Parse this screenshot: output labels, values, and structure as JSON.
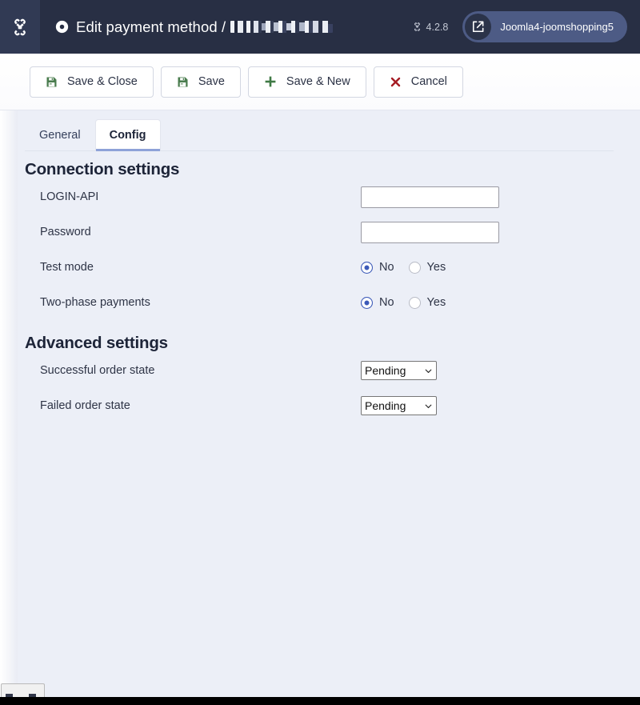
{
  "topbar": {
    "brand_icon": "joomla-logo-icon",
    "title_dot_icon": "circle-dot-icon",
    "title": "Edit payment method /",
    "title_redacted": true,
    "version_icon": "joomla-mark-icon",
    "version": "4.2.8",
    "site_link_icon": "external-link-icon",
    "site_name": "Joomla4-joomshopping5"
  },
  "toolbar": {
    "buttons": [
      {
        "label": "Save & Close",
        "icon": "save-icon",
        "icon_color": "#4a7c4e"
      },
      {
        "label": "Save",
        "icon": "save-icon",
        "icon_color": "#4a7c4e"
      },
      {
        "label": "Save & New",
        "icon": "plus-icon",
        "icon_color": "#3f7a45"
      },
      {
        "label": "Cancel",
        "icon": "close-x-icon",
        "icon_color": "#a51c24"
      }
    ]
  },
  "tabs": [
    {
      "label": "General",
      "active": false
    },
    {
      "label": "Config",
      "active": true
    }
  ],
  "sections": [
    {
      "title": "Connection settings",
      "fields": [
        {
          "label": "LOGIN-API",
          "type": "text",
          "value": "",
          "placeholder": ""
        },
        {
          "label": "Password",
          "type": "text",
          "value": "",
          "placeholder": ""
        },
        {
          "label": "Test mode",
          "type": "radio",
          "options": [
            "No",
            "Yes"
          ],
          "selected": "No"
        },
        {
          "label": "Two-phase payments",
          "type": "radio",
          "options": [
            "No",
            "Yes"
          ],
          "selected": "No"
        }
      ]
    },
    {
      "title": "Advanced settings",
      "fields": [
        {
          "label": "Successful order state",
          "type": "select",
          "value": "Pending",
          "arrow_icon": "chevron-down-icon"
        },
        {
          "label": "Failed order state",
          "type": "select",
          "value": "Pending",
          "arrow_icon": "chevron-down-icon"
        }
      ]
    }
  ],
  "colors": {
    "topbar_bg": "#282f44",
    "content_bg": "#eceff7",
    "accent_blue": "#3c5ab8",
    "tab_underline": "#8ea2d8",
    "save_green": "#4a7c4e",
    "cancel_red": "#a51c24"
  }
}
